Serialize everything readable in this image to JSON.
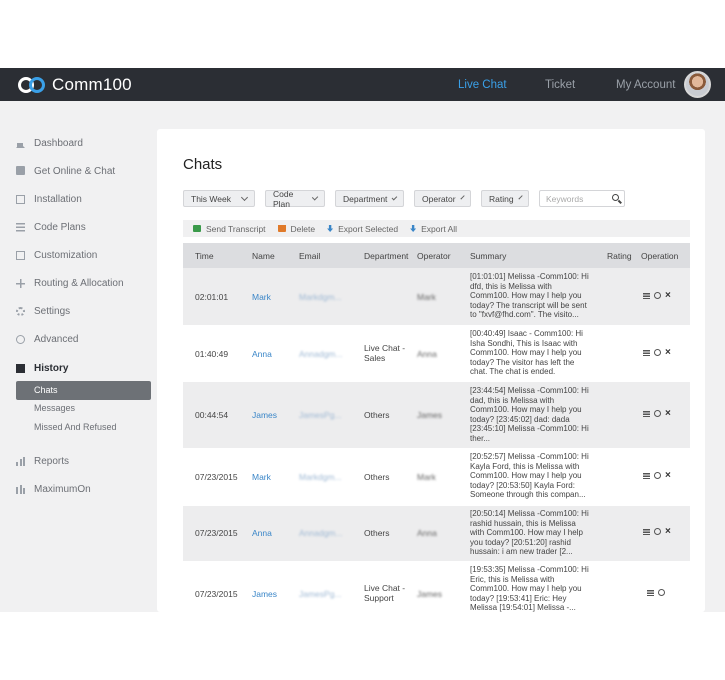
{
  "app": {
    "name": "Comm100"
  },
  "topnav": {
    "live_chat": "Live Chat",
    "ticket": "Ticket",
    "my_account": "My Account"
  },
  "sidebar": {
    "items": [
      {
        "label": "Dashboard",
        "icon": "house-icon"
      },
      {
        "label": "Get Online & Chat",
        "icon": "chat-icon"
      },
      {
        "label": "Installation",
        "icon": "box-icon"
      },
      {
        "label": "Code Plans",
        "icon": "list-icon"
      },
      {
        "label": "Customization",
        "icon": "edit-icon"
      },
      {
        "label": "Routing & Allocation",
        "icon": "route-icon"
      },
      {
        "label": "Settings",
        "icon": "gear-icon"
      },
      {
        "label": "Advanced",
        "icon": "advanced-icon"
      },
      {
        "label": "History",
        "icon": "mail-icon"
      },
      {
        "label": "Reports",
        "icon": "bar-chart-icon"
      },
      {
        "label": "MaximumOn",
        "icon": "maximumon-icon"
      }
    ],
    "history_sub": [
      "Chats",
      "Messages",
      "Missed And Refused"
    ]
  },
  "page": {
    "title": "Chats"
  },
  "filters": {
    "period": "This Week",
    "code_plan": "Code Plan",
    "department": "Department",
    "operator": "Operator",
    "rating": "Rating",
    "keywords_placeholder": "Keywords"
  },
  "actions": {
    "send_transcript": "Send Transcript",
    "delete": "Delete",
    "export_selected": "Export Selected",
    "export_all": "Export All"
  },
  "table": {
    "headers": {
      "time": "Time",
      "name": "Name",
      "email": "Email",
      "department": "Department",
      "operator": "Operator",
      "summary": "Summary",
      "rating": "Rating",
      "operation": "Operation"
    },
    "rows": [
      {
        "time": "02:01:01",
        "name": "Mark",
        "email": "Markdgm...",
        "department": "",
        "operator": "Mark",
        "summary": [
          "[01:01:01] Melissa -Comm100: Hi",
          "dfd, this is Melissa with",
          "Comm100. How may I help you",
          "today? The transcript will be sent",
          "to \"fxvf@fhd.com\". The visito..."
        ]
      },
      {
        "time": "01:40:49",
        "name": "Anna",
        "email": "Annadgm...",
        "department": "Live Chat - Sales",
        "operator": "Anna",
        "summary": [
          "[00:40:49] Isaac - Comm100: Hi",
          "Isha Sondhi, This is Isaac with",
          "Comm100. How may I help you",
          "today? The visitor has left the",
          "chat. The chat is ended."
        ]
      },
      {
        "time": "00:44:54",
        "name": "James",
        "email": "JamesPg...",
        "department": "Others",
        "operator": "James",
        "summary": [
          "[23:44:54] Melissa -Comm100: Hi",
          "dad, this is Melissa with",
          "Comm100. How may I help you",
          "today? [23:45:02] dad: dada",
          "[23:45:10] Melissa -Comm100: Hi",
          "ther..."
        ]
      },
      {
        "time": "07/23/2015",
        "name": "Mark",
        "email": "Markdgm...",
        "department": "Others",
        "operator": "Mark",
        "summary": [
          "[20:52:57] Melissa -Comm100: Hi",
          "Kayla Ford, this is Melissa with",
          "Comm100. How may I help you",
          "today? [20:53:50] Kayla Ford:",
          "Someone through this compan..."
        ]
      },
      {
        "time": "07/23/2015",
        "name": "Anna",
        "email": "Annadgm...",
        "department": "Others",
        "operator": "Anna",
        "summary": [
          "[20:50:14] Melissa -Comm100: Hi",
          "rashid hussain, this is Melissa",
          "with Comm100. How may I help",
          "you today? [20:51:20] rashid",
          "hussain: i am new trader [2..."
        ]
      },
      {
        "time": "07/23/2015",
        "name": "James",
        "email": "JamesPg...",
        "department": "Live Chat - Support",
        "operator": "James",
        "summary": [
          "[19:53:35] Melissa -Comm100: Hi",
          "Eric, this is Melissa with",
          "Comm100. How may I help you",
          "today? [19:53:41] Eric: Hey",
          "Melissa [19:54:01] Melissa -..."
        ]
      }
    ]
  },
  "colors": {
    "accent": "#3a86c8",
    "topbar": "#2b2e34",
    "live_chat_active": "#3aa0e8"
  }
}
